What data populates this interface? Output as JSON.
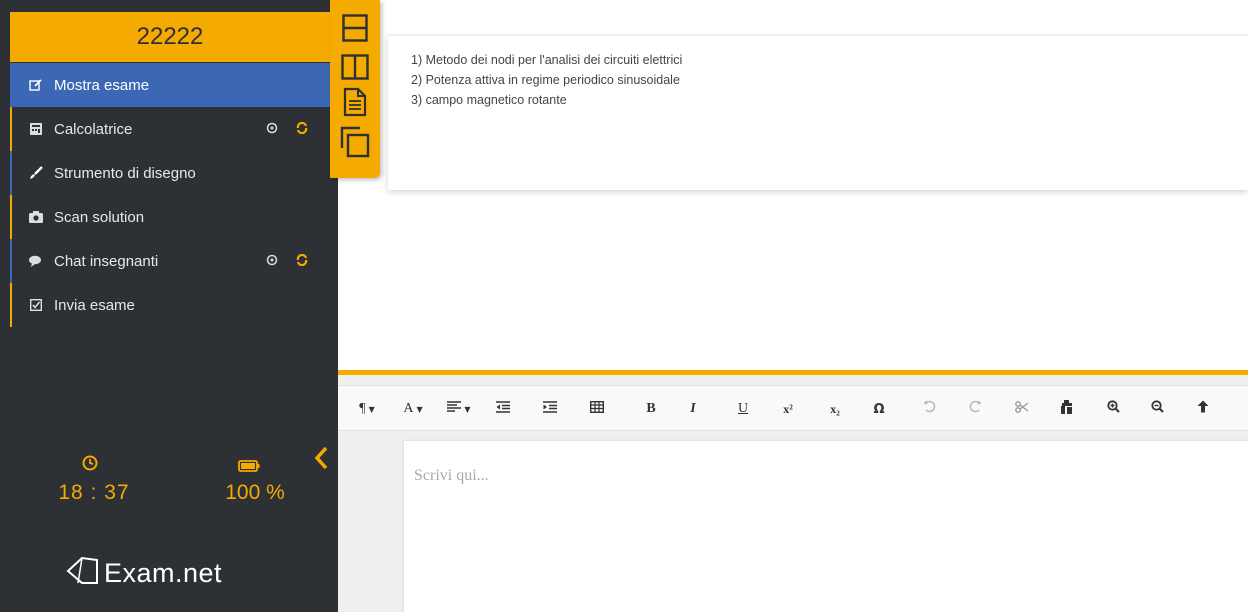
{
  "sidebar": {
    "code": "22222",
    "menu": [
      {
        "label": "Mostra esame",
        "icon": "edit-icon"
      },
      {
        "label": "Calcolatrice",
        "icon": "calculator-icon"
      },
      {
        "label": "Strumento di disegno",
        "icon": "brush-icon"
      },
      {
        "label": "Scan solution",
        "icon": "camera-icon"
      },
      {
        "label": "Chat insegnanti",
        "icon": "chat-icon"
      },
      {
        "label": "Invia esame",
        "icon": "checkbox-icon"
      }
    ],
    "time": "18 : 37",
    "battery": "100 %",
    "logo_text": "Exam.net"
  },
  "layout_buttons": [
    "split-horizontal-icon",
    "split-vertical-icon",
    "document-icon",
    "copy-icon"
  ],
  "question": {
    "lines": [
      "1) Metodo dei nodi per l'analisi dei circuiti elettrici",
      "2) Potenza attiva in regime periodico sinusoidale",
      "3) campo magnetico rotante"
    ]
  },
  "toolbar": {
    "paragraph": "¶",
    "font": "A",
    "bold": "B",
    "italic": "I",
    "underline": "U",
    "superscript": "x²",
    "subscript": "x₂",
    "special_char": "Ω"
  },
  "editor": {
    "placeholder": "Scrivi qui..."
  },
  "colors": {
    "accent": "#f5aa00",
    "sidebar": "#2d3034",
    "active": "#3c67b5"
  }
}
